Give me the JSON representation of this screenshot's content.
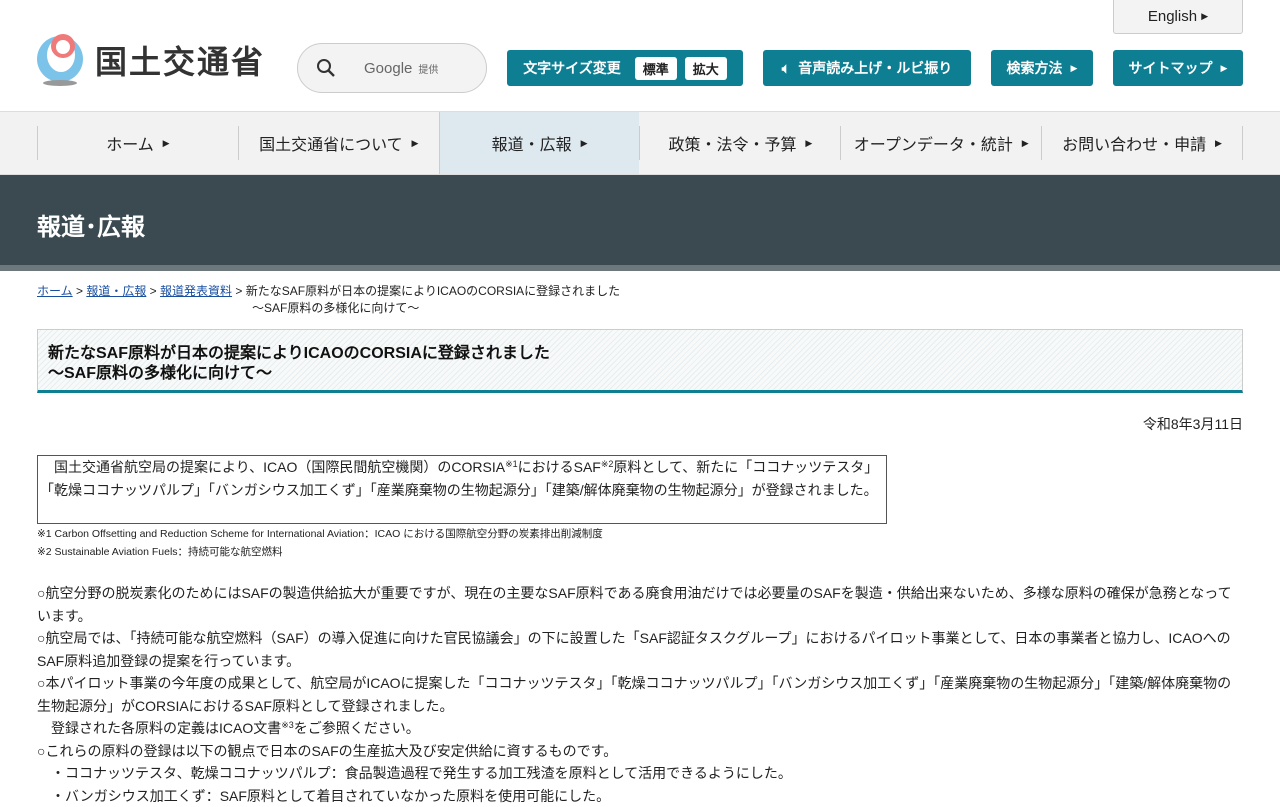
{
  "header": {
    "logo_text": "国土交通省",
    "search_brand": "Google",
    "search_provided": "提供",
    "english": "English",
    "font_size_label": "文字サイズ変更",
    "font_standard": "標準",
    "font_large": "拡大",
    "speech": "音声読み上げ・ルビ振り",
    "search_method": "検索方法",
    "sitemap": "サイトマップ"
  },
  "nav": [
    "ホーム",
    "国土交通省について",
    "報道・広報",
    "政策・法令・予算",
    "オープンデータ・統計",
    "お問い合わせ・申請"
  ],
  "banner": "報道･広報",
  "breadcrumb": {
    "items": [
      "ホーム",
      "報道・広報",
      "報道発表資料"
    ],
    "current_1": "新たなSAF原料が日本の提案によりICAOのCORSIAに登録されました",
    "current_2": "～SAF原料の多様化に向けて～"
  },
  "title": {
    "line1": "新たなSAF原料が日本の提案によりICAOのCORSIAに登録されました",
    "line2": "～SAF原料の多様化に向けて～"
  },
  "date": "令和8年3月11日",
  "summary": {
    "a": "　国土交通省航空局の提案により、ICAO（国際民間航空機関）のCORSIA",
    "s1": "※1",
    "b": "におけるSAF",
    "s2": "※2",
    "c": "原料として、新たに「ココナッツテスタ」「乾燥ココナッツパルプ」「バンガシウス加工くず」「産業廃棄物の生物起源分」「建築/解体廃棄物の生物起源分」が登録されました。"
  },
  "notes": [
    "※1 Carbon Offsetting and Reduction Scheme for International Aviation：ICAO における国際航空分野の炭素排出削減制度",
    "※2 Sustainable Aviation Fuels：持続可能な航空燃料"
  ],
  "body": {
    "p1": "○航空分野の脱炭素化のためにはSAFの製造供給拡大が重要ですが、現在の主要なSAF原料である廃食用油だけでは必要量のSAFを製造・供給出来ないため、多様な原料の確保が急務となっています。",
    "p2": "○航空局では、「持続可能な航空燃料（SAF）の導入促進に向けた官民協議会」の下に設置した「SAF認証タスクグループ」におけるパイロット事業として、日本の事業者と協力し、ICAOへのSAF原料追加登録の提案を行っています。",
    "p3": "○本パイロット事業の今年度の成果として、航空局がICAOに提案した「ココナッツテスタ」「乾燥ココナッツパルプ」「バンガシウス加工くず」「産業廃棄物の生物起源分」「建築/解体廃棄物の生物起源分」がCORSIAにおけるSAF原料として登録されました。",
    "p4a": "　登録された各原料の定義はICAO文書",
    "p4s": "※3",
    "p4b": "をご参照ください。",
    "p5": "○これらの原料の登録は以下の観点で日本のSAFの生産拡大及び安定供給に資するものです。",
    "p6": "　・ココナッツテスタ、乾燥ココナッツパルプ：食品製造過程で発生する加工残渣を原料として活用できるようにした。",
    "p7": "　・バンガシウス加工くず：SAF原料として着目されていなかった原料を使用可能にした。"
  },
  "colors": {
    "accent": "#0e7e93",
    "banner": "#3b4a51"
  }
}
